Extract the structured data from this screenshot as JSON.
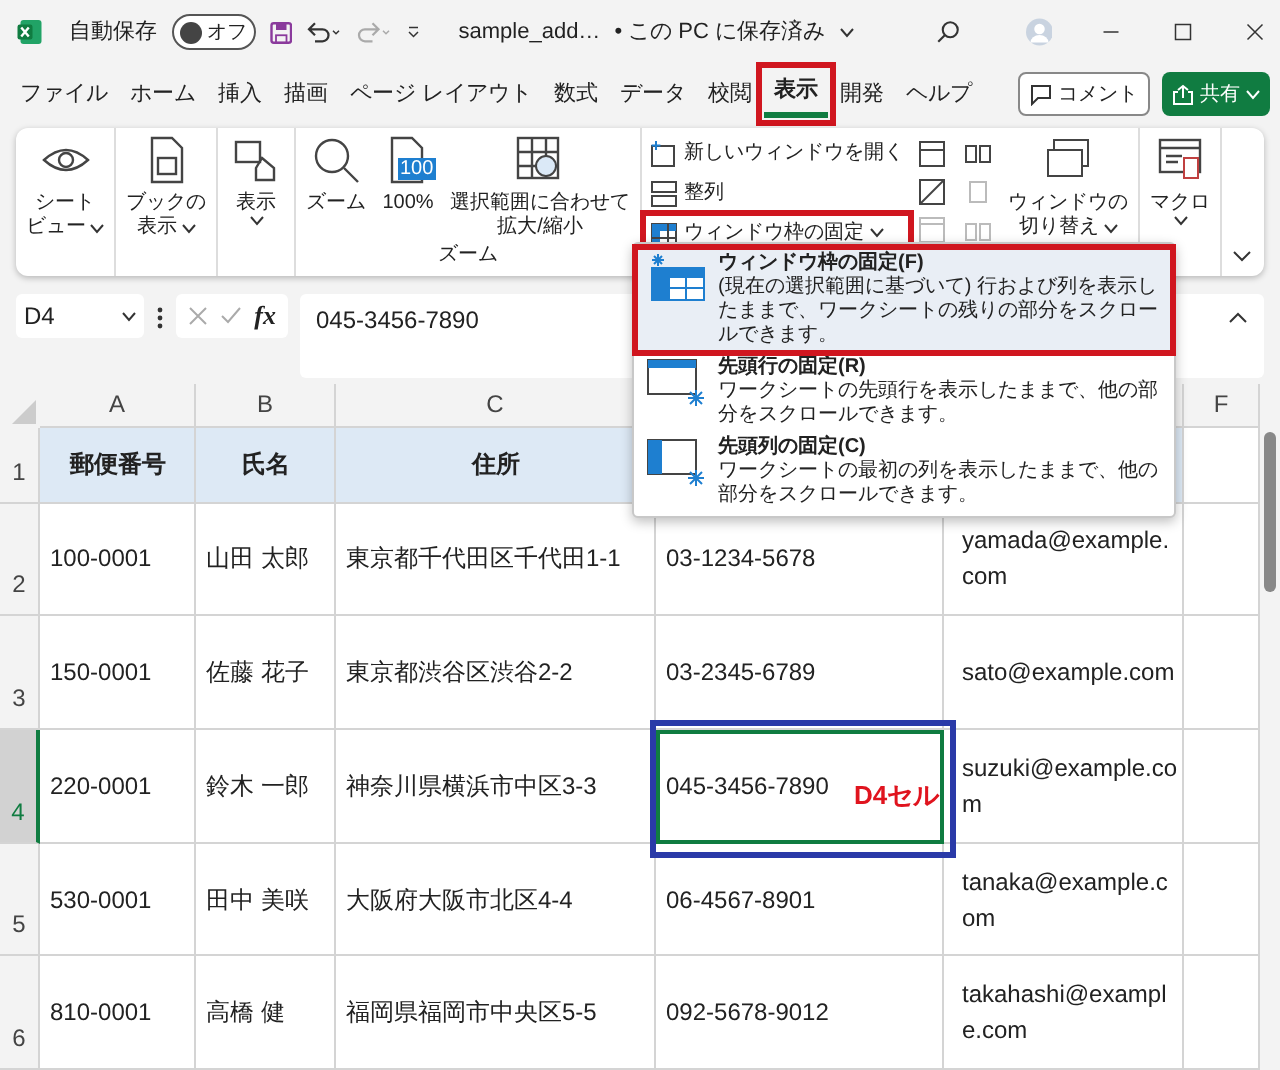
{
  "title_bar": {
    "autosave_label": "自動保存",
    "autosave": {
      "label": "オフ",
      "on": false
    },
    "filename": "sample_add…",
    "save_status": "• この PC に保存済み"
  },
  "menu_tabs": [
    {
      "label": "ファイル",
      "selected": false,
      "highlighted": false
    },
    {
      "label": "ホーム",
      "selected": false,
      "highlighted": false
    },
    {
      "label": "挿入",
      "selected": false,
      "highlighted": false
    },
    {
      "label": "描画",
      "selected": false,
      "highlighted": false
    },
    {
      "label": "ページ レイアウト",
      "selected": false,
      "highlighted": false
    },
    {
      "label": "数式",
      "selected": false,
      "highlighted": false
    },
    {
      "label": "データ",
      "selected": false,
      "highlighted": false
    },
    {
      "label": "校閲",
      "selected": false,
      "highlighted": false
    },
    {
      "label": "表示",
      "selected": true,
      "highlighted": true
    },
    {
      "label": "開発",
      "selected": false,
      "highlighted": false
    },
    {
      "label": "ヘルプ",
      "selected": false,
      "highlighted": false
    }
  ],
  "comment_button": "コメント",
  "share_button": "共有",
  "ribbon": {
    "groups": [
      {
        "buttons": [
          {
            "kind": "large",
            "lines": [
              "シート",
              "ビュー"
            ],
            "dropdown": true
          }
        ]
      },
      {
        "buttons": [
          {
            "kind": "large",
            "lines": [
              "ブックの",
              "表示"
            ],
            "dropdown": true
          }
        ]
      },
      {
        "buttons": [
          {
            "kind": "large",
            "lines": [
              "表示"
            ],
            "dropdown": true
          }
        ]
      },
      {
        "label": "ズーム",
        "buttons": [
          {
            "kind": "large",
            "lines": [
              "ズーム"
            ],
            "dropdown": false
          },
          {
            "kind": "large",
            "icon_text": "100",
            "lines": [
              "100%"
            ],
            "dropdown": false
          },
          {
            "kind": "large",
            "lines": [
              "選択範囲に合わせて",
              "拡大/縮小"
            ],
            "dropdown": false
          }
        ]
      },
      {
        "buttons": [
          {
            "kind": "small",
            "lines": [
              "新しいウィンドウを開く"
            ],
            "dropdown": false,
            "highlighted": false
          },
          {
            "kind": "small",
            "lines": [
              "整列"
            ],
            "dropdown": false,
            "highlighted": false
          },
          {
            "kind": "small",
            "lines": [
              "ウィンドウ枠の固定"
            ],
            "dropdown": true,
            "highlighted": true
          },
          {
            "kind": "icons"
          },
          {
            "kind": "icons"
          },
          {
            "kind": "large",
            "lines": [
              "ウィンドウの",
              "切り替え"
            ],
            "dropdown": true
          }
        ]
      },
      {
        "buttons": [
          {
            "kind": "large",
            "lines": [
              "マクロ"
            ],
            "dropdown": true
          }
        ]
      }
    ]
  },
  "formula_bar": {
    "name_box": "D4",
    "function_button": "fx",
    "formula": "045-3456-7890"
  },
  "sheet": {
    "column_headers": [
      "A",
      "B",
      "C",
      "F"
    ],
    "rows": [
      {
        "number": "1",
        "kind": "header",
        "selected": false,
        "cells": [
          "郵便番号",
          "氏名",
          "住所"
        ]
      },
      {
        "number": "2",
        "kind": "data",
        "selected": false,
        "cells": [
          "100-0001",
          "山田 太郎",
          "東京都千代田区千代田1-1",
          "03-1234-5678",
          "yamada@example.com"
        ]
      },
      {
        "number": "3",
        "kind": "data",
        "selected": false,
        "cells": [
          "150-0001",
          "佐藤 花子",
          "東京都渋谷区渋谷2-2",
          "03-2345-6789",
          "sato@example.com"
        ]
      },
      {
        "number": "4",
        "kind": "data",
        "selected": true,
        "cells": [
          "220-0001",
          "鈴木 一郎",
          "神奈川県横浜市中区3-3",
          "045-3456-7890",
          "suzuki@example.com"
        ]
      },
      {
        "number": "5",
        "kind": "data",
        "selected": false,
        "cells": [
          "530-0001",
          "田中 美咲",
          "大阪府大阪市北区4-4",
          "06-4567-8901",
          "tanaka@example.com"
        ]
      },
      {
        "number": "6",
        "kind": "data",
        "selected": false,
        "cells": [
          "810-0001",
          "高橋 健",
          "福岡県福岡市中央区5-5",
          "092-5678-9012",
          "takahashi@example.com"
        ]
      }
    ]
  },
  "freeze_menu": {
    "items": [
      {
        "title": "ウィンドウ枠の固定(F)",
        "description": "(現在の選択範囲に基づいて) 行および列を表示したままで、ワークシートの残りの部分をスクロールできます。",
        "selected": true,
        "highlighted": true
      },
      {
        "title": "先頭行の固定(R)",
        "description": "ワークシートの先頭行を表示したままで、他の部分をスクロールできます。",
        "selected": false,
        "highlighted": false
      },
      {
        "title": "先頭列の固定(C)",
        "description": "ワークシートの最初の列を表示したままで、他の部分をスクロールできます。",
        "selected": false,
        "highlighted": false
      }
    ]
  },
  "annotation": {
    "label": "D4セル"
  }
}
